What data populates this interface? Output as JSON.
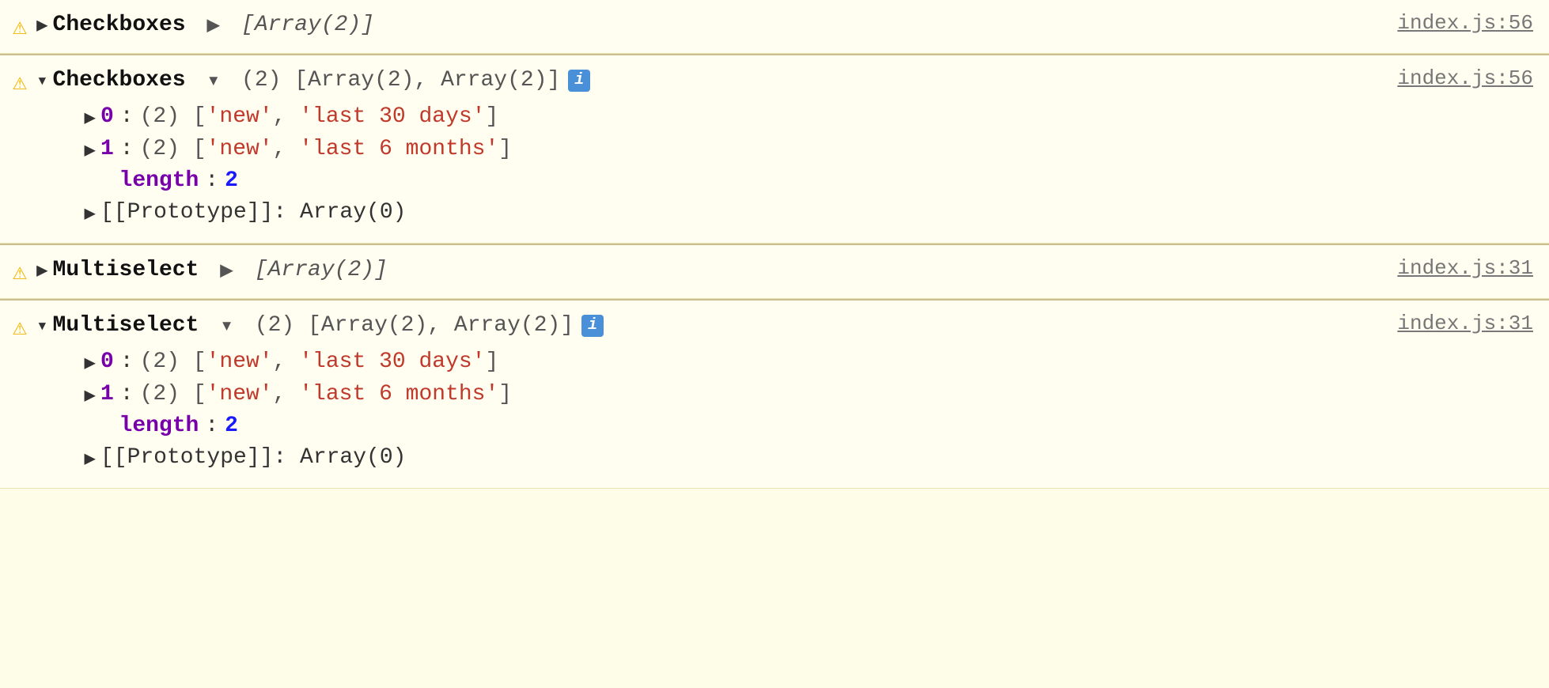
{
  "rows": [
    {
      "id": "row1",
      "warning": "⚠",
      "expanded": false,
      "label": "Checkboxes",
      "arrow_direction": "right",
      "main_text": "[Array(2)]",
      "main_text_italic": true,
      "show_count": false,
      "show_info": false,
      "file_link": "index.js:56",
      "children": []
    },
    {
      "id": "row2",
      "warning": "⚠",
      "expanded": true,
      "label": "Checkboxes",
      "arrow_direction": "down",
      "count": "(2)",
      "array_parts": "[Array(2), Array(2)]",
      "show_info": true,
      "file_link": "index.js:56",
      "children": [
        {
          "index": "0",
          "count": "(2)",
          "values": [
            "'new'",
            "'last 30 days'"
          ]
        },
        {
          "index": "1",
          "count": "(2)",
          "values": [
            "'new'",
            "'last 6 months'"
          ]
        }
      ],
      "length_value": "2",
      "prototype_text": "[[Prototype]]: Array(0)"
    },
    {
      "id": "row3",
      "warning": "⚠",
      "expanded": false,
      "label": "Multiselect",
      "arrow_direction": "right",
      "main_text": "[Array(2)]",
      "main_text_italic": true,
      "show_count": false,
      "show_info": false,
      "file_link": "index.js:31",
      "children": []
    },
    {
      "id": "row4",
      "warning": "⚠",
      "expanded": true,
      "label": "Multiselect",
      "arrow_direction": "down",
      "count": "(2)",
      "array_parts": "[Array(2), Array(2)]",
      "show_info": true,
      "file_link": "index.js:31",
      "children": [
        {
          "index": "0",
          "count": "(2)",
          "values": [
            "'new'",
            "'last 30 days'"
          ]
        },
        {
          "index": "1",
          "count": "(2)",
          "values": [
            "'new'",
            "'last 6 months'"
          ]
        }
      ],
      "length_value": "2",
      "prototype_text": "[[Prototype]]: Array(0)"
    }
  ],
  "labels": {
    "length": "length",
    "colon": ":",
    "arrow_right": "▶",
    "arrow_down": "▾",
    "info_icon": "i"
  }
}
